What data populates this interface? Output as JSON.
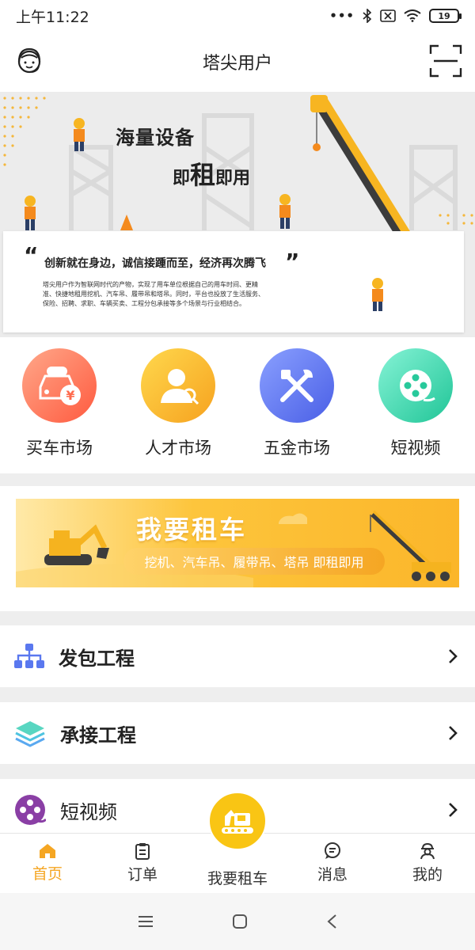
{
  "status_bar": {
    "time": "上午11:22",
    "icons": [
      "dots-icon",
      "bluetooth-icon",
      "sim-icon",
      "wifi-icon"
    ],
    "battery": "19"
  },
  "header": {
    "title": "塔尖用户",
    "left_icon": "customer-service-icon",
    "right_icon": "scan-icon"
  },
  "banner": {
    "headline1": "海量设备",
    "headline2_a": "即",
    "headline2_b": "租",
    "headline2_c": "即用",
    "quote_open": "“",
    "quote_close": "”",
    "quote": "创新就在身边，诚信接踵而至，经济再次腾飞",
    "description": "塔尖用户作为智联网时代的产物，实现了用车单位根据自己的用车时间、更精准、快捷地租用挖机、汽车吊、履带吊和塔吊。同时，平台也投放了生活服务、保险、招聘、求职、车辆买卖、工程分包承接等多个场景与行业相结合。"
  },
  "quick_entries": [
    {
      "label": "买车市场",
      "icon": "car-market-icon",
      "badge": "买车",
      "color_from": "#ff9a7a",
      "color_to": "#ff5f45"
    },
    {
      "label": "人才市场",
      "icon": "talent-icon",
      "color_from": "#ffd34a",
      "color_to": "#f8a722"
    },
    {
      "label": "五金市场",
      "icon": "tools-icon",
      "color_from": "#7f96ff",
      "color_to": "#4e63e8"
    },
    {
      "label": "短视频",
      "icon": "video-reel-icon",
      "color_from": "#7ef0d2",
      "color_to": "#23c79a"
    }
  ],
  "rent_banner": {
    "title": "我要租车",
    "subtitle": "挖机、汽车吊、履带吊、塔吊 即租即用"
  },
  "menu": [
    {
      "label": "发包工程",
      "icon": "org-chart-icon"
    },
    {
      "label": "承接工程",
      "icon": "layers-icon"
    },
    {
      "label": "短视频",
      "icon": "video-reel-icon"
    }
  ],
  "bottom_nav": {
    "items": [
      {
        "label": "首页",
        "icon": "home-icon",
        "active": true
      },
      {
        "label": "订单",
        "icon": "clipboard-icon",
        "active": false
      },
      {
        "label": "我要租车",
        "icon": "excavator-icon",
        "active": false
      },
      {
        "label": "消息",
        "icon": "chat-icon",
        "active": false
      },
      {
        "label": "我的",
        "icon": "worker-icon",
        "active": false
      }
    ]
  },
  "colors": {
    "accent": "#f5a623",
    "brand_yellow": "#f9c514",
    "crane_yellow": "#f7b521"
  }
}
